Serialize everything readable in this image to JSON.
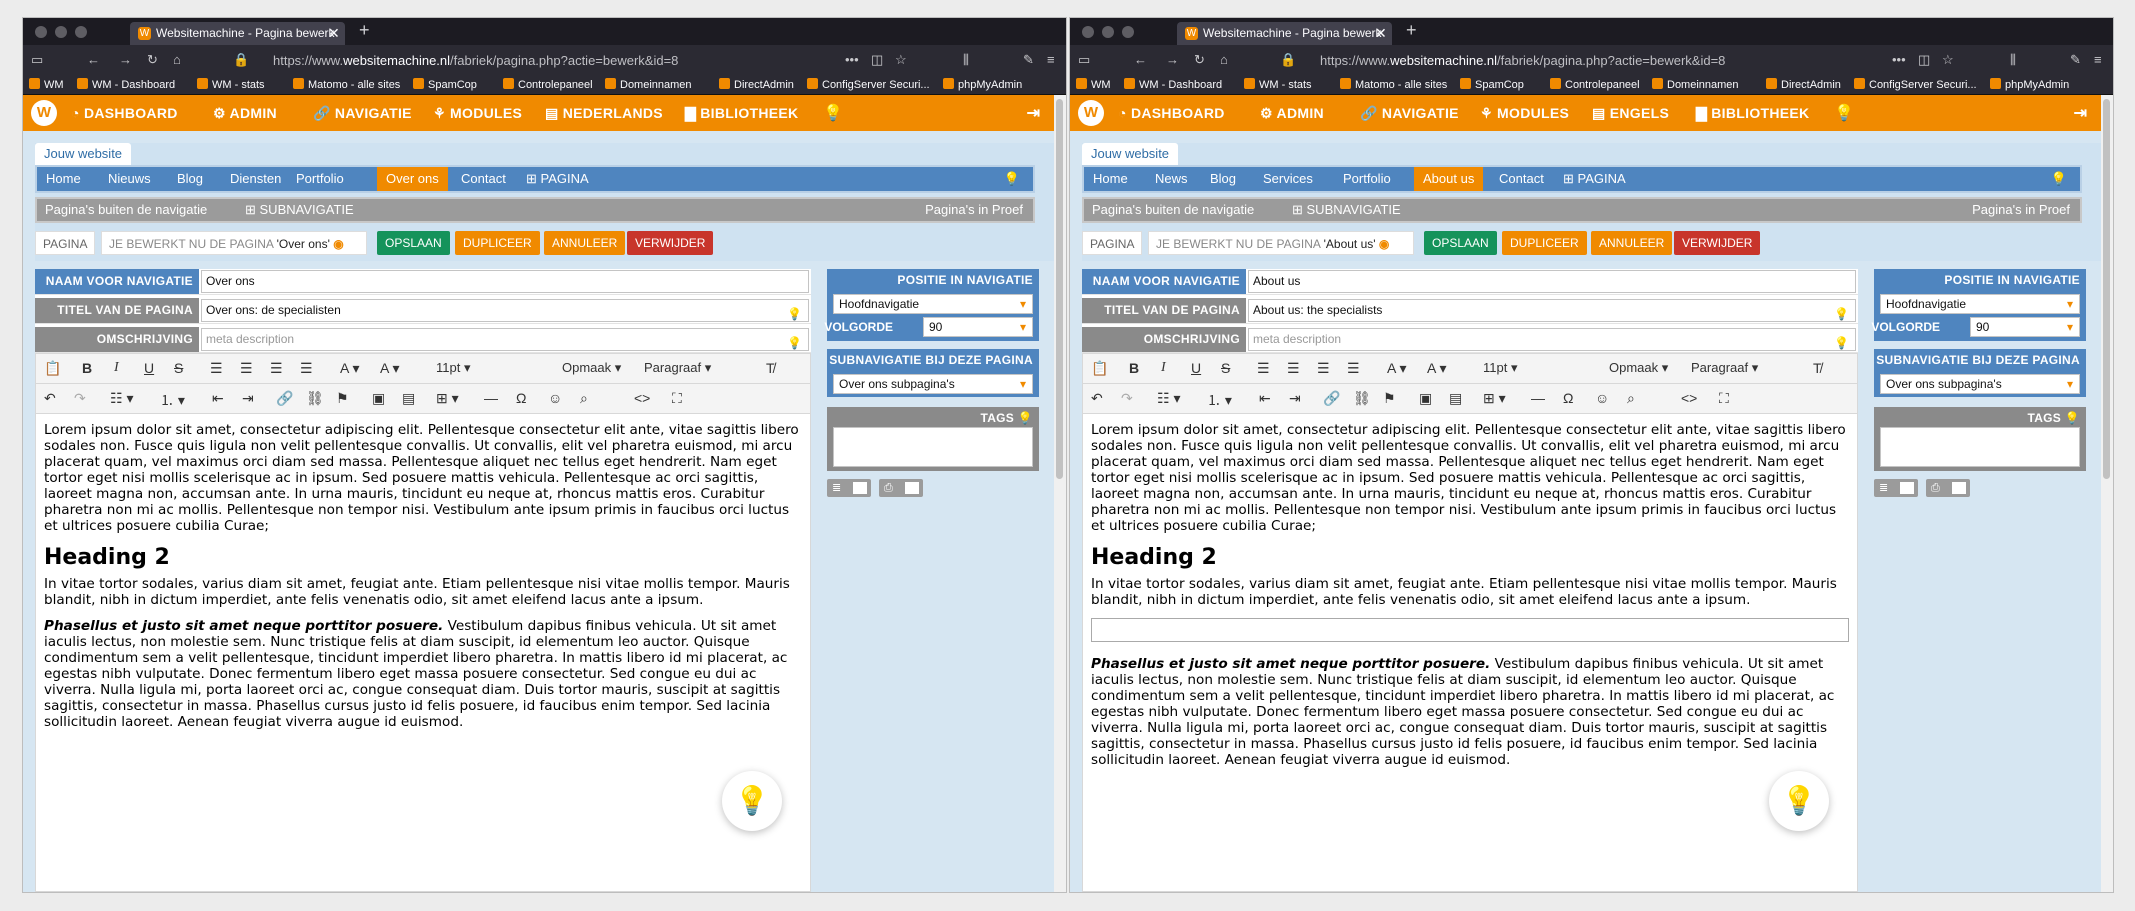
{
  "browser": {
    "tab_title": "Websitemachine - Pagina bewerk",
    "tab_favicon": "W",
    "url_prefix": "https://www.",
    "url_domain": "websitemachine.nl",
    "url_path": "/fabriek/pagina.php?actie=bewerk&id=8",
    "bookmarks": [
      "WM",
      "WM - Dashboard",
      "WM - stats",
      "Matomo - alle sites",
      "SpamCop",
      "Controlepaneel",
      "Domeinnamen",
      "DirectAdmin",
      "ConfigServer Securi...",
      "phpMyAdmin"
    ]
  },
  "colors": {
    "orange": "#f08a00",
    "blue": "#4f85bf",
    "green": "#15935b",
    "red": "#c8352b",
    "gray": "#8a8a8a"
  },
  "windows": [
    {
      "topnav": [
        "DASHBOARD",
        "ADMIN",
        "NAVIGATIE",
        "MODULES",
        "NEDERLANDS",
        "BIBLIOTHEEK"
      ],
      "site_tab": "Jouw website",
      "menu": [
        "Home",
        "Nieuws",
        "Blog",
        "Diensten",
        "Portfolio",
        "Over ons",
        "Contact",
        "PAGINA"
      ],
      "menu_active": "Over ons",
      "submenu_left": "Pagina's buiten de navigatie",
      "submenu_mid": "SUBNAVIGATIE",
      "submenu_right": "Pagina's in Proef",
      "page_btn": "PAGINA",
      "editing_prefix": "JE BEWERKT NU DE PAGINA",
      "editing_page": "'Over ons'",
      "buttons": {
        "save": "OPSLAAN",
        "duplicate": "DUPLICEER",
        "cancel": "ANNULEER",
        "delete": "VERWIJDER"
      },
      "fields": {
        "nav_label": "NAAM VOOR NAVIGATIE",
        "nav_value": "Over ons",
        "title_label": "TITEL VAN DE PAGINA",
        "title_value": "Over ons: de specialisten",
        "desc_label": "OMSCHRIJVING",
        "desc_placeholder": "meta description"
      },
      "toolbar": {
        "font_size": "11pt",
        "format": "Opmaak",
        "block": "Paragraaf"
      },
      "side": {
        "position_head": "POSITIE IN NAVIGATIE",
        "position_value": "Hoofdnavigatie",
        "order_label": "VOLGORDE",
        "order_value": "90",
        "subnav_head": "SUBNAVIGATIE BIJ DEZE PAGINA",
        "subnav_value": "Over ons subpagina's",
        "tags_head": "TAGS"
      },
      "content": {
        "p1": "Lorem ipsum dolor sit amet, consectetur adipiscing elit. Pellentesque consectetur elit ante, vitae sagittis libero sodales non. Fusce quis ligula non velit pellentesque convallis. Ut convallis, elit vel pharetra euismod, mi arcu placerat quam, vel maximus orci diam sed massa. Pellentesque aliquet nec tellus eget hendrerit. Nam eget tortor eget nisi mollis scelerisque ac in ipsum. Sed posuere mattis vehicula. Pellentesque ac orci sagittis, laoreet magna non, accumsan ante. In urna mauris, tincidunt eu neque at, rhoncus mattis eros. Curabitur pharetra non mi ac mollis. Pellentesque non tempor nisi. Vestibulum ante ipsum primis in faucibus orci luctus et ultrices posuere cubilia Curae;",
        "h2": "Heading 2",
        "p2": "In vitae tortor sodales, varius diam sit amet, feugiat ante. Etiam pellentesque nisi vitae mollis tempor. Mauris blandit, nibh in dictum imperdiet, ante felis venenatis odio, sit amet eleifend lacus ante a ipsum.",
        "p3_bold": "Phasellus et justo sit amet neque porttitor posuere.",
        "p3": " Vestibulum dapibus finibus vehicula. Ut sit amet iaculis lectus, non molestie sem. Nunc tristique felis at diam suscipit, id elementum leo auctor. Quisque condimentum sem a velit pellentesque, tincidunt imperdiet libero pharetra. In mattis libero id mi placerat, ac egestas nibh vulputate. Donec fermentum libero eget massa posuere consectetur. Sed congue eu dui ac viverra. Nulla ligula mi, porta laoreet orci ac, congue consequat diam. Duis tortor mauris, suscipit at sagittis sagittis, consectetur in massa. Phasellus cursus justo id felis posuere, id faucibus enim tempor. Sed lacinia sollicitudin laoreet. Aenean feugiat viverra augue id euismod."
      }
    },
    {
      "topnav": [
        "DASHBOARD",
        "ADMIN",
        "NAVIGATIE",
        "MODULES",
        "ENGELS",
        "BIBLIOTHEEK"
      ],
      "site_tab": "Jouw website",
      "menu": [
        "Home",
        "News",
        "Blog",
        "Services",
        "Portfolio",
        "About us",
        "Contact",
        "PAGINA"
      ],
      "menu_active": "About us",
      "submenu_left": "Pagina's buiten de navigatie",
      "submenu_mid": "SUBNAVIGATIE",
      "submenu_right": "Pagina's in Proef",
      "page_btn": "PAGINA",
      "editing_prefix": "JE BEWERKT NU DE PAGINA",
      "editing_page": "'About us'",
      "buttons": {
        "save": "OPSLAAN",
        "duplicate": "DUPLICEER",
        "cancel": "ANNULEER",
        "delete": "VERWIJDER"
      },
      "fields": {
        "nav_label": "NAAM VOOR NAVIGATIE",
        "nav_value": "About us",
        "title_label": "TITEL VAN DE PAGINA",
        "title_value": "About us: the specialists",
        "desc_label": "OMSCHRIJVING",
        "desc_placeholder": "meta description"
      },
      "toolbar": {
        "font_size": "11pt",
        "format": "Opmaak",
        "block": "Paragraaf"
      },
      "side": {
        "position_head": "POSITIE IN NAVIGATIE",
        "position_value": "Hoofdnavigatie",
        "order_label": "VOLGORDE",
        "order_value": "90",
        "subnav_head": "SUBNAVIGATIE BIJ DEZE PAGINA",
        "subnav_value": "Over ons subpagina's",
        "tags_head": "TAGS"
      },
      "content": {
        "p1": "Lorem ipsum dolor sit amet, consectetur adipiscing elit. Pellentesque consectetur elit ante, vitae sagittis libero sodales non. Fusce quis ligula non velit pellentesque convallis. Ut convallis, elit vel pharetra euismod, mi arcu placerat quam, vel maximus orci diam sed massa. Pellentesque aliquet nec tellus eget hendrerit. Nam eget tortor eget nisi mollis scelerisque ac in ipsum. Sed posuere mattis vehicula. Pellentesque ac orci sagittis, laoreet magna non, accumsan ante. In urna mauris, tincidunt eu neque at, rhoncus mattis eros. Curabitur pharetra non mi ac mollis. Pellentesque non tempor nisi. Vestibulum ante ipsum primis in faucibus orci luctus et ultrices posuere cubilia Curae;",
        "h2": "Heading 2",
        "p2": "In vitae tortor sodales, varius diam sit amet, feugiat ante. Etiam pellentesque nisi vitae mollis tempor. Mauris blandit, nibh in dictum imperdiet, ante felis venenatis odio, sit amet eleifend lacus ante a ipsum.",
        "p3_bold": "Phasellus et justo sit amet neque porttitor posuere.",
        "p3": " Vestibulum dapibus finibus vehicula. Ut sit amet iaculis lectus, non molestie sem. Nunc tristique felis at diam suscipit, id elementum leo auctor. Quisque condimentum sem a velit pellentesque, tincidunt imperdiet libero pharetra. In mattis libero id mi placerat, ac egestas nibh vulputate. Donec fermentum libero eget massa posuere consectetur. Sed congue eu dui ac viverra. Nulla ligula mi, porta laoreet orci ac, congue consequat diam. Duis tortor mauris, suscipit at sagittis sagittis, consectetur in massa. Phasellus cursus justo id felis posuere, id faucibus enim tempor. Sed lacinia sollicitudin laoreet. Aenean feugiat viverra augue id euismod."
      }
    }
  ]
}
